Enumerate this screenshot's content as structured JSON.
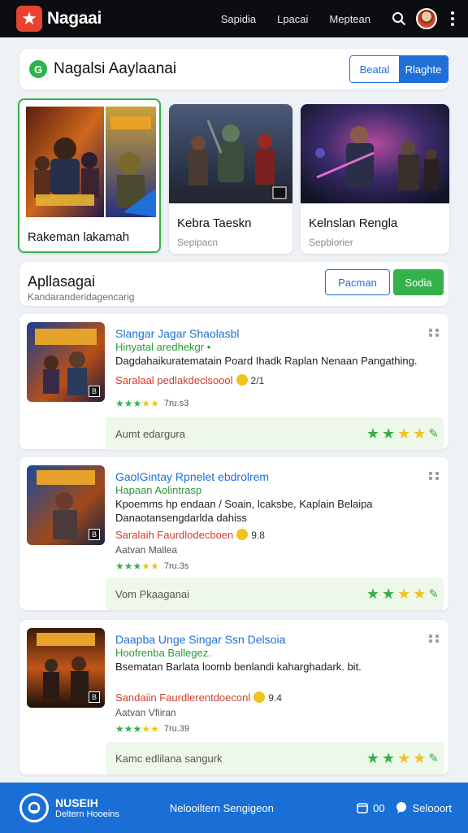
{
  "topbar": {
    "brand": "Nagaai",
    "nav": [
      "Sapidia",
      "Lpacai",
      "Meptean"
    ]
  },
  "header": {
    "icon_letter": "G",
    "title": "Nagalsi Aaylaanai",
    "seg_a": "Beatal",
    "seg_b": "Rlaghte"
  },
  "featured": [
    {
      "title": "Rakeman lakamah",
      "subtitle": "",
      "badge": ""
    },
    {
      "title": "Kebra Taeskn",
      "subtitle": "Sepipacn",
      "badge": "D"
    },
    {
      "title": "Kelnslan Rengla",
      "subtitle": "Sepblorier",
      "badge": ""
    }
  ],
  "section": {
    "title": "Apllasagai",
    "subtitle": "Kandaranderidagencarig",
    "btn_outline": "Pacman",
    "btn_green": "Sodia"
  },
  "items": [
    {
      "title": "Slangar Jagar Shaolasbl",
      "category": "Hinyatal aredhekgr",
      "category_tag": "•",
      "desc": "Dagdahaikuratematain Poard Ihadk Raplan Nenaan Pangathing.",
      "price": "Saralaal pedlakdeclsoool",
      "price_num": "2/1",
      "author": "",
      "rating_count": "7ru.s3",
      "footer": "Aumt edargura",
      "badge": "B"
    },
    {
      "title": "GaolGintay Rpnelet ebdrolrem",
      "category": "Hapaan Aolintrasp",
      "category_tag": "",
      "desc": "Kpoemms hp endaan / Soain, lcaksbe, Kaplain Belaipa Danaotansengdarlda dahiss",
      "price": "Saralaih Faurdlodecboen",
      "price_num": "9.8",
      "author": "Aatvan Mallea",
      "rating_count": "7ru.3s",
      "footer": "Vom Pkaaganai",
      "badge": "B"
    },
    {
      "title": "Daapba Unge Singar Ssn Delsoia",
      "category": "Hoofrenba Ballegez.",
      "category_tag": "",
      "desc": "Bsematan Barlata loomb benlandi kaharghadark. bit.",
      "price": "Sandaiin Faurdlerentdoeconl",
      "price_num": "9.4",
      "author": "Aatvan Vfiiran",
      "rating_count": "7ru.39",
      "footer": "Kamc edlilana sangurk",
      "badge": "B"
    }
  ],
  "footer": {
    "brand": "NUSEIH",
    "brand_sub": "Deltern Hooeins",
    "middle": "Nelooiltern Sengigeon",
    "right_count": "00",
    "right_label": "Selooort"
  },
  "colors": {
    "accent_blue": "#1e6fd8",
    "accent_green": "#35b14a",
    "price_red": "#d33a2b",
    "topbar": "#0c0d10"
  }
}
